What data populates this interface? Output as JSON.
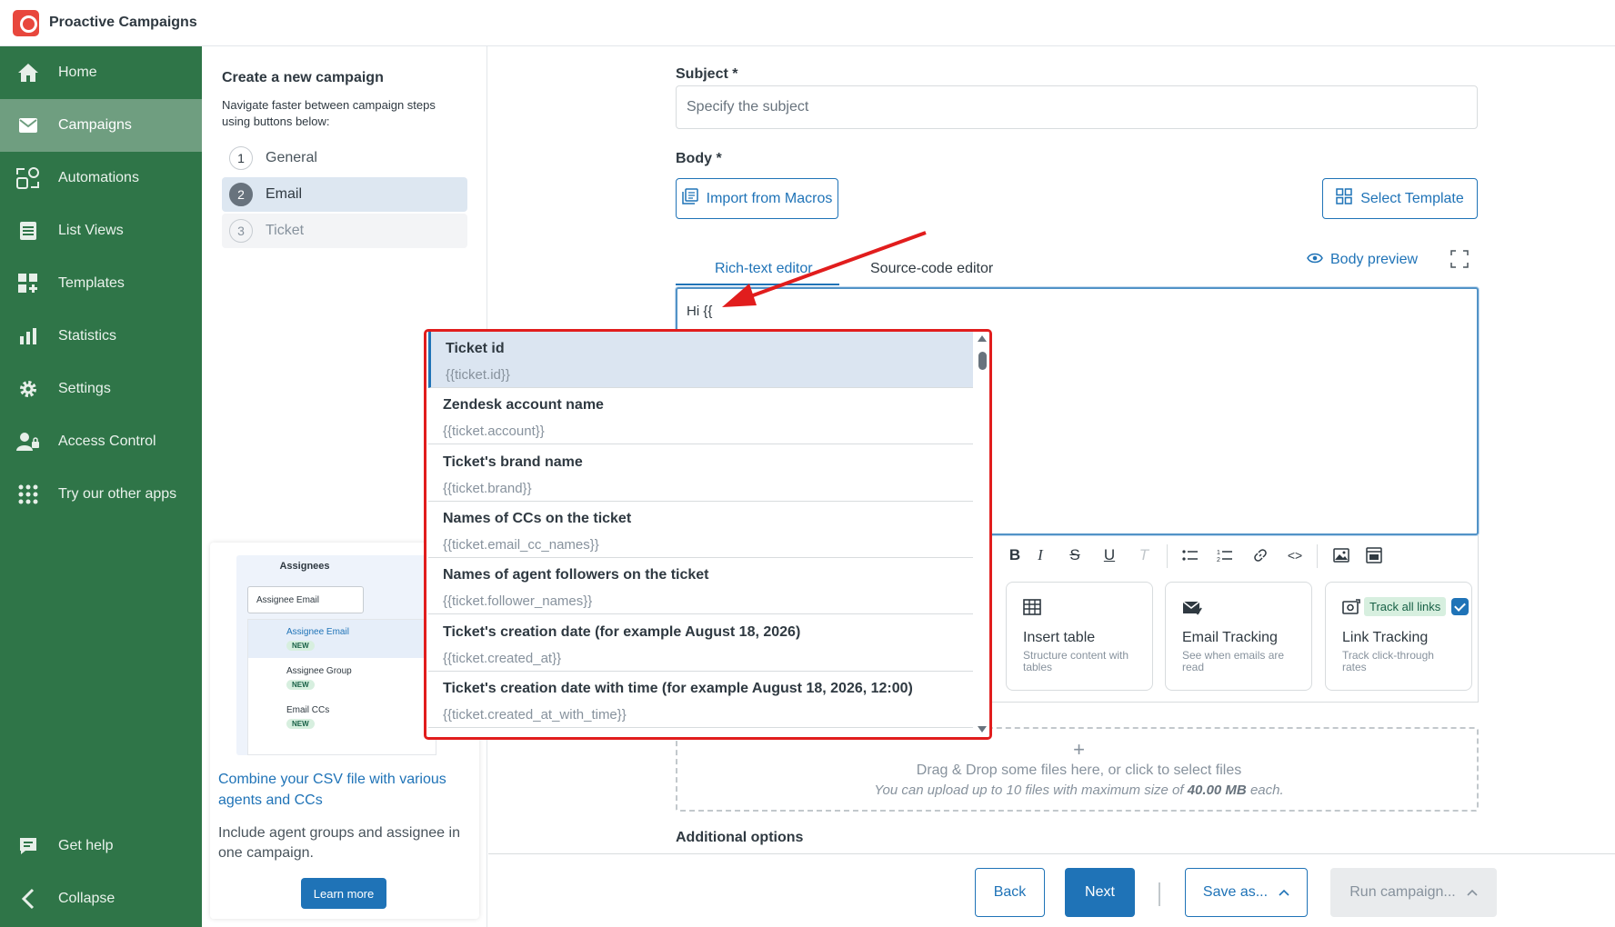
{
  "app": {
    "title": "Proactive Campaigns"
  },
  "sidebar": {
    "items": [
      {
        "label": "Home",
        "icon": "home-icon"
      },
      {
        "label": "Campaigns",
        "icon": "mail-icon",
        "active": true
      },
      {
        "label": "Automations",
        "icon": "automations-icon"
      },
      {
        "label": "List Views",
        "icon": "list-icon"
      },
      {
        "label": "Templates",
        "icon": "templates-icon"
      },
      {
        "label": "Statistics",
        "icon": "bar-chart-icon"
      },
      {
        "label": "Settings",
        "icon": "gear-icon"
      },
      {
        "label": "Access Control",
        "icon": "user-lock-icon"
      },
      {
        "label": "Try our other apps",
        "icon": "apps-grid-icon"
      }
    ],
    "get_help": "Get help",
    "collapse": "Collapse"
  },
  "steps": {
    "title": "Create a new campaign",
    "description": "Navigate faster between campaign steps using buttons below:",
    "items": [
      {
        "num": "1",
        "label": "General",
        "state": "done"
      },
      {
        "num": "2",
        "label": "Email",
        "state": "active"
      },
      {
        "num": "3",
        "label": "Ticket",
        "state": "disabled"
      }
    ]
  },
  "promo": {
    "shot_header": "Assignees",
    "shot_select": "Assignee Email",
    "shot_options": [
      "Assignee Email",
      "Assignee Group",
      "Email CCs"
    ],
    "badge": "NEW",
    "title": "Combine your CSV file with various agents and CCs",
    "text": "Include agent groups and assignee in one campaign.",
    "button": "Learn more"
  },
  "form": {
    "subject_label": "Subject *",
    "subject_placeholder": "Specify the subject",
    "body_label": "Body *",
    "import_macros": "Import from Macros",
    "select_template": "Select Template",
    "tab_rich": "Rich-text editor",
    "tab_source": "Source-code editor",
    "body_preview": "Body preview",
    "editor_text": "Hi {{"
  },
  "features": [
    {
      "title": "Insert table",
      "desc": "Structure content with tables",
      "icon": "table-icon"
    },
    {
      "title": "Email Tracking",
      "desc": "See when emails are read",
      "icon": "email-tracking-icon"
    },
    {
      "title": "Link Tracking",
      "desc": "Track click-through rates",
      "icon": "link-tracking-icon",
      "pill": "Track all links",
      "checked": true
    }
  ],
  "dropzone": {
    "plus": "+",
    "line1": "Drag & Drop some files here, or click to select files",
    "line2_prefix": "You can upload up to 10 files with maximum size of",
    "line2_size": "40.00 MB",
    "line2_suffix": "each."
  },
  "additional_options": "Additional options",
  "footer": {
    "back": "Back",
    "next": "Next",
    "save_as": "Save as...",
    "run_campaign": "Run campaign..."
  },
  "placeholders": [
    {
      "name": "Ticket id",
      "code": "{{ticket.id}}"
    },
    {
      "name": "Zendesk account name",
      "code": "{{ticket.account}}"
    },
    {
      "name": "Ticket's brand name",
      "code": "{{ticket.brand}}"
    },
    {
      "name": "Names of CCs on the ticket",
      "code": "{{ticket.email_cc_names}}"
    },
    {
      "name": "Names of agent followers on the ticket",
      "code": "{{ticket.follower_names}}"
    },
    {
      "name": "Ticket's creation date (for example August 18, 2026)",
      "code": "{{ticket.created_at}}"
    },
    {
      "name": "Ticket's creation date with time (for example August 18, 2026, 12:00)",
      "code": "{{ticket.created_at_with_time}}"
    }
  ],
  "colors": {
    "sidebar": "#2f7548",
    "accent": "#1f73b7",
    "highlight": "#e11d1d"
  }
}
